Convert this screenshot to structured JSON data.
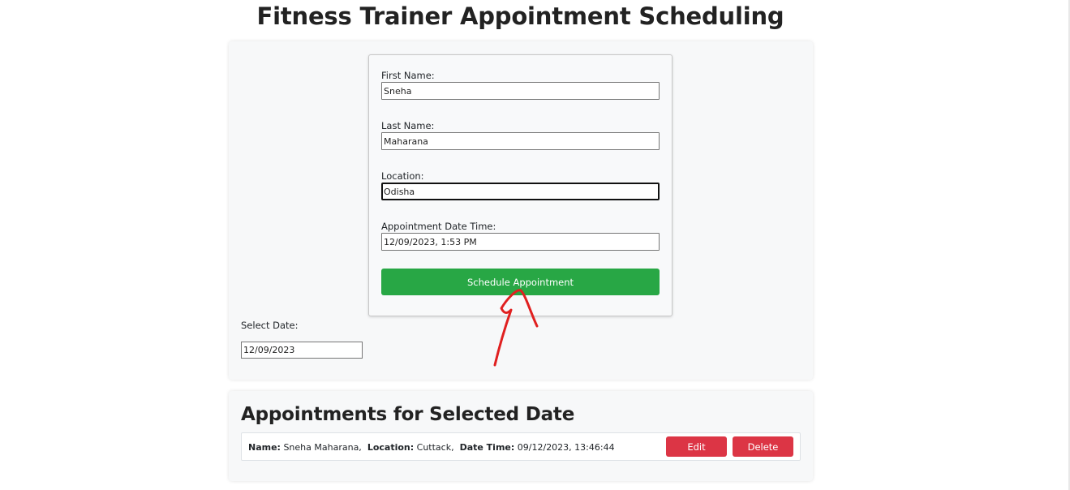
{
  "page": {
    "title": "Fitness Trainer Appointment Scheduling"
  },
  "form": {
    "first_name_label": "First Name:",
    "first_name_value": "Sneha",
    "last_name_label": "Last Name:",
    "last_name_value": "Maharana",
    "location_label": "Location:",
    "location_value": "Odisha",
    "datetime_label": "Appointment Date Time:",
    "datetime_value": "12/09/2023, 1:53 PM",
    "submit_label": "Schedule Appointment"
  },
  "date_filter": {
    "label": "Select Date:",
    "value": "12/09/2023"
  },
  "appointments": {
    "title": "Appointments for Selected Date",
    "items": [
      {
        "name_key": "Name:",
        "name": "Sneha Maharana,",
        "location_key": "Location:",
        "location": "Cuttack,",
        "datetime_key": "Date Time:",
        "datetime": "09/12/2023, 13:46:44",
        "edit_label": "Edit",
        "delete_label": "Delete"
      }
    ]
  },
  "colors": {
    "success": "#28a745",
    "danger": "#dc3545",
    "annotation": "#e02020"
  }
}
